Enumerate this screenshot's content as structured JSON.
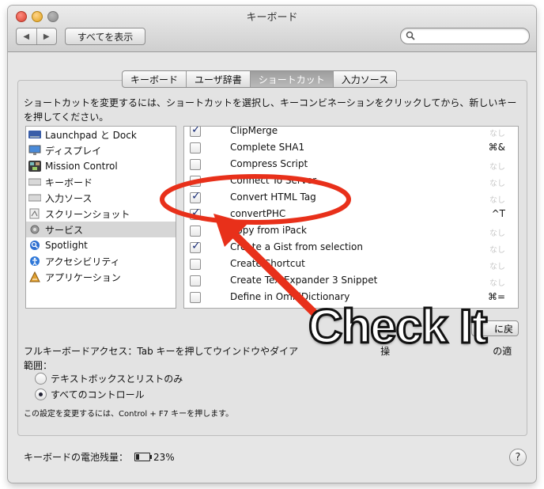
{
  "window": {
    "title": "キーボード",
    "show_all_label": "すべてを表示",
    "back_glyph": "◀",
    "forward_glyph": "▶"
  },
  "tabs": [
    {
      "label": "キーボード",
      "active": false
    },
    {
      "label": "ユーザ辞書",
      "active": false
    },
    {
      "label": "ショートカット",
      "active": true
    },
    {
      "label": "入力ソース",
      "active": false
    }
  ],
  "description": "ショートカットを変更するには、ショートカットを選択し、キーコンビネーションをクリックしてから、新しいキーを押してください。",
  "categories": [
    {
      "label": "Launchpad と Dock",
      "icon": "launchpad-icon",
      "selected": false
    },
    {
      "label": "ディスプレイ",
      "icon": "display-icon",
      "selected": false
    },
    {
      "label": "Mission Control",
      "icon": "mission-control-icon",
      "selected": false
    },
    {
      "label": "キーボード",
      "icon": "keyboard-icon",
      "selected": false
    },
    {
      "label": "入力ソース",
      "icon": "input-source-icon",
      "selected": false
    },
    {
      "label": "スクリーンショット",
      "icon": "screenshot-icon",
      "selected": false
    },
    {
      "label": "サービス",
      "icon": "gear-icon",
      "selected": true
    },
    {
      "label": "Spotlight",
      "icon": "spotlight-icon",
      "selected": false
    },
    {
      "label": "アクセシビリティ",
      "icon": "accessibility-icon",
      "selected": false
    },
    {
      "label": "アプリケーション",
      "icon": "application-icon",
      "selected": false
    }
  ],
  "shortcuts": [
    {
      "name": "ClipMerge",
      "checked": true,
      "key": "なし"
    },
    {
      "name": "Complete SHA1",
      "checked": false,
      "key": "⌘&"
    },
    {
      "name": "Compress Script",
      "checked": false,
      "key": "なし"
    },
    {
      "name": "Connect To Server",
      "checked": false,
      "key": "なし"
    },
    {
      "name": "Convert HTML Tag",
      "checked": true,
      "key": "なし"
    },
    {
      "name": "convertPHC",
      "checked": true,
      "key": "^T"
    },
    {
      "name": "Copy from iPack",
      "checked": false,
      "key": "なし"
    },
    {
      "name": "Create a Gist from selection",
      "checked": true,
      "key": "なし"
    },
    {
      "name": "Create Shortcut",
      "checked": false,
      "key": "なし"
    },
    {
      "name": "Create TextExpander 3 Snippet",
      "checked": false,
      "key": "なし"
    },
    {
      "name": "Define in OmniDictionary",
      "checked": false,
      "key": "⌘="
    }
  ],
  "restore_button_label": "に戻",
  "full_keyboard_access": {
    "label": "フルキーボードアクセス：Tab キーを押してウインドウやダイア",
    "label_tail": "操",
    "label_tail2": "の適",
    "label_line2": "範囲：",
    "options": [
      {
        "label": "テキストボックスとリストのみ",
        "selected": false
      },
      {
        "label": "すべてのコントロール",
        "selected": true
      }
    ],
    "note": "この設定を変更するには、Control + F7 キーを押します。"
  },
  "battery": {
    "label": "キーボードの電池残量：",
    "percent_text": "23%",
    "level": 0.23
  },
  "help_label": "?",
  "annotation": {
    "text": "Check It",
    "color": "#e8301a"
  }
}
